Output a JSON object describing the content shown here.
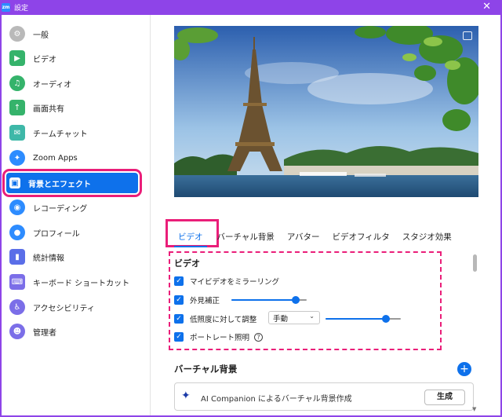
{
  "window": {
    "title": "設定",
    "logo": "zm"
  },
  "sidebar": {
    "items": [
      {
        "label": "一般",
        "icon": "gear-icon",
        "color": "#b9b9b9"
      },
      {
        "label": "ビデオ",
        "icon": "video-icon",
        "color": "#35b36b"
      },
      {
        "label": "オーディオ",
        "icon": "headphones-icon",
        "color": "#35b36b"
      },
      {
        "label": "画面共有",
        "icon": "screen-share-icon",
        "color": "#35b36b"
      },
      {
        "label": "チームチャット",
        "icon": "chat-icon",
        "color": "#3eb8a8"
      },
      {
        "label": "Zoom Apps",
        "icon": "apps-icon",
        "color": "#2d8cff"
      },
      {
        "label": "背景とエフェクト",
        "icon": "background-icon",
        "color": "#0e71eb",
        "active": true
      },
      {
        "label": "レコーディング",
        "icon": "record-icon",
        "color": "#2d8cff"
      },
      {
        "label": "プロフィール",
        "icon": "profile-icon",
        "color": "#2d8cff"
      },
      {
        "label": "統計情報",
        "icon": "stats-icon",
        "color": "#5a6ee8"
      },
      {
        "label": "キーボード ショートカット",
        "icon": "keyboard-icon",
        "color": "#7b6ee8"
      },
      {
        "label": "アクセシビリティ",
        "icon": "accessibility-icon",
        "color": "#7b6ee8"
      },
      {
        "label": "管理者",
        "icon": "admin-icon",
        "color": "#7b6ee8"
      }
    ]
  },
  "tabs": [
    {
      "label": "ビデオ",
      "active": true
    },
    {
      "label": "バーチャル背景"
    },
    {
      "label": "アバター"
    },
    {
      "label": "ビデオフィルタ"
    },
    {
      "label": "スタジオ効果"
    }
  ],
  "video": {
    "title": "ビデオ",
    "mirror": {
      "label": "マイビデオをミラーリング",
      "checked": true
    },
    "touchup": {
      "label": "外見補正",
      "checked": true,
      "level": 0.85
    },
    "lowlight": {
      "label": "低照度に対して調整",
      "checked": true,
      "mode": "手動",
      "level": 0.8
    },
    "portrait": {
      "label": "ポートレート照明",
      "checked": true
    }
  },
  "virtual_bg": {
    "title": "バーチャル背景",
    "ai_label": "AI Companion によるバーチャル背景作成",
    "generate_label": "生成"
  },
  "colors": {
    "accent": "#0e71eb",
    "highlight": "#ea1e79",
    "titlebar": "#8e44e8"
  }
}
